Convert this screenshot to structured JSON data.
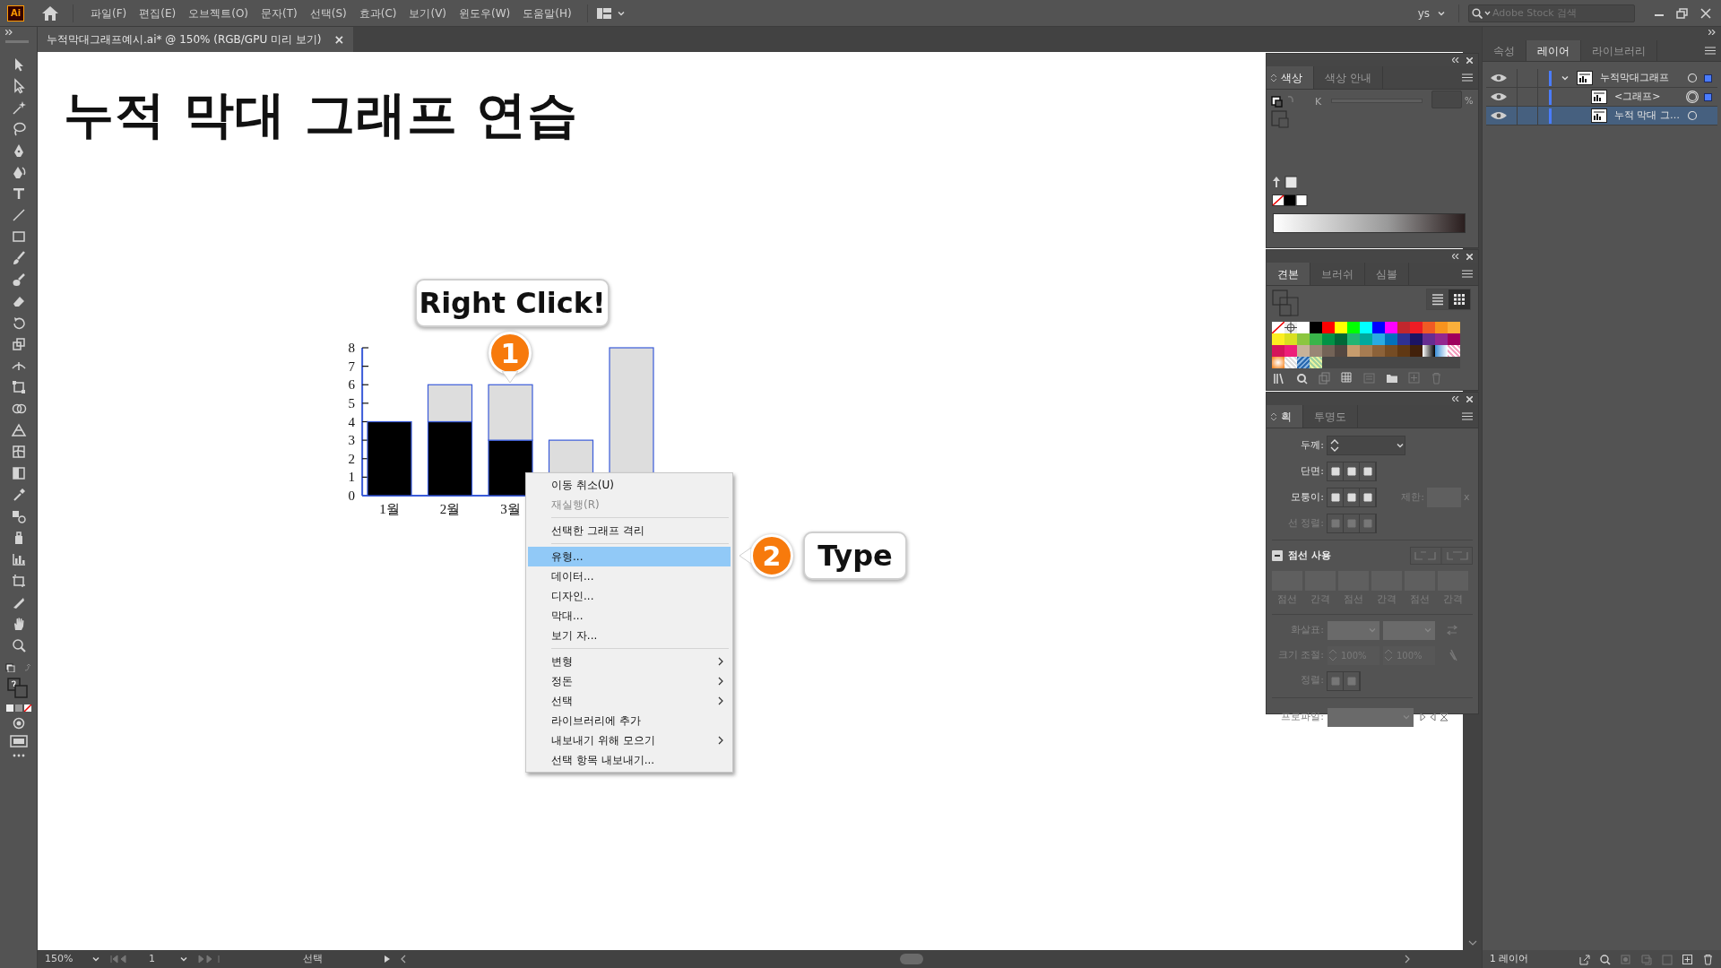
{
  "app": {
    "logo": "Ai",
    "menus": [
      "파일(F)",
      "편집(E)",
      "오브젝트(O)",
      "문자(T)",
      "선택(S)",
      "효과(C)",
      "보기(V)",
      "윈도우(W)",
      "도움말(H)"
    ],
    "user": "ys",
    "search": {
      "placeholder": "Adobe Stock 검색"
    }
  },
  "document_tab": {
    "title": "누적막대그래프예시.ai* @ 150% (RGB/GPU 미리 보기)",
    "close": "×"
  },
  "artboard": {
    "heading": "누적 막대 그래프 연습",
    "callouts": [
      {
        "kind": "bubble",
        "text": "Right Click!"
      },
      {
        "kind": "badge",
        "text": "1"
      },
      {
        "kind": "badge",
        "text": "2"
      },
      {
        "kind": "bubble",
        "text": "Type"
      }
    ],
    "chart_data": {
      "type": "bar",
      "stacked": true,
      "x": [
        1,
        2,
        3,
        4,
        5
      ],
      "xlim": [
        0.55,
        5.4
      ],
      "xticks": [
        {
          "value": 1,
          "label": "1월"
        },
        {
          "value": 2,
          "label": "2월"
        },
        {
          "value": 3,
          "label": "3월"
        }
      ],
      "ylim": [
        0,
        8
      ],
      "yticks": [
        0,
        1,
        2,
        3,
        4,
        5,
        6,
        7,
        8
      ],
      "series": [
        {
          "color": "#000000",
          "values": [
            4,
            4,
            3,
            0,
            0
          ]
        },
        {
          "color": "#dddddd",
          "values": [
            0,
            2,
            3,
            3,
            8
          ]
        }
      ]
    }
  },
  "context_menu": {
    "groups": [
      [
        {
          "label": "이동 취소(U)",
          "disabled": false,
          "selected": false,
          "submenu": false
        },
        {
          "label": "재실행(R)",
          "disabled": true,
          "selected": false,
          "submenu": false
        }
      ],
      [
        {
          "label": "선택한 그래프 격리",
          "disabled": false,
          "selected": false,
          "submenu": false
        }
      ],
      [
        {
          "label": "유형...",
          "disabled": false,
          "selected": true,
          "submenu": false
        },
        {
          "label": "데이터...",
          "disabled": false,
          "selected": false,
          "submenu": false
        },
        {
          "label": "디자인...",
          "disabled": false,
          "selected": false,
          "submenu": false
        },
        {
          "label": "막대...",
          "disabled": false,
          "selected": false,
          "submenu": false
        },
        {
          "label": "보기 자...",
          "disabled": false,
          "selected": false,
          "submenu": false
        }
      ],
      [
        {
          "label": "변형",
          "disabled": false,
          "selected": false,
          "submenu": true
        },
        {
          "label": "정돈",
          "disabled": false,
          "selected": false,
          "submenu": true
        },
        {
          "label": "선택",
          "disabled": false,
          "selected": false,
          "submenu": true
        },
        {
          "label": "라이브러리에 추가",
          "disabled": false,
          "selected": false,
          "submenu": false
        },
        {
          "label": "내보내기 위해 모으기",
          "disabled": false,
          "selected": false,
          "submenu": true
        },
        {
          "label": "선택 항목 내보내기...",
          "disabled": false,
          "selected": false,
          "submenu": false
        }
      ]
    ]
  },
  "color_panel": {
    "tabs": [
      {
        "label": "색상",
        "selected": true
      },
      {
        "label": "색상 안내",
        "selected": false
      }
    ],
    "channel": {
      "label": "K",
      "unit": "%",
      "disabled": true
    }
  },
  "swatches_panel": {
    "tabs": [
      {
        "label": "견본",
        "selected": true
      },
      {
        "label": "브러쉬",
        "selected": false
      },
      {
        "label": "심볼",
        "selected": false
      }
    ],
    "swatches": [
      {
        "color": "#ffffff"
      },
      {
        "color": "#000000"
      },
      {
        "color": "#ff0000"
      },
      {
        "color": "#ffff00"
      },
      {
        "color": "#00ff00"
      },
      {
        "color": "#00ffff"
      },
      {
        "color": "#0000ff"
      },
      {
        "color": "#ff00ff"
      },
      {
        "color": "#c1272d"
      },
      {
        "color": "#ed1c24"
      },
      {
        "color": "#f15a24"
      },
      {
        "color": "#f7931e"
      },
      {
        "color": "#fbb03b"
      },
      {
        "color": "#fcee21"
      },
      {
        "color": "#d9e021"
      },
      {
        "color": "#8cc63f"
      },
      {
        "color": "#39b54a"
      },
      {
        "color": "#009245"
      },
      {
        "color": "#006837"
      },
      {
        "color": "#22b573"
      },
      {
        "color": "#00a99d"
      },
      {
        "color": "#29abe2"
      },
      {
        "color": "#0071bc"
      },
      {
        "color": "#2e3192"
      },
      {
        "color": "#1b1464"
      },
      {
        "color": "#662d91"
      },
      {
        "color": "#93278f"
      },
      {
        "color": "#9e005d"
      },
      {
        "color": "#d4145a"
      },
      {
        "color": "#ed1e79"
      },
      {
        "color": "#c7b299"
      },
      {
        "color": "#998675"
      },
      {
        "color": "#736357"
      },
      {
        "color": "#534741"
      },
      {
        "color": "#c69c6d"
      },
      {
        "color": "#a67c52"
      },
      {
        "color": "#8c6239"
      },
      {
        "color": "#754c24"
      },
      {
        "color": "#603813"
      },
      {
        "color": "#42210b"
      }
    ]
  },
  "stroke_panel": {
    "tabs": [
      {
        "label": "획",
        "selected": true
      },
      {
        "label": "투명도",
        "selected": false
      }
    ],
    "weight": {
      "label": "두께:",
      "disabled": false
    },
    "cap": {
      "label": "단면:",
      "disabled": false
    },
    "corner": {
      "label": "모퉁이:",
      "disabled": false
    },
    "limit": {
      "label": "제한:",
      "unit": "x",
      "disabled": true
    },
    "align": {
      "label": "선 정렬:",
      "disabled": true
    },
    "dashed": {
      "label": "점선 사용",
      "indeterminate": true
    },
    "dash_fields": [
      "점선",
      "간격",
      "점선",
      "간격",
      "점선",
      "간격"
    ],
    "arrowheads": {
      "label": "화살표:",
      "disabled": true
    },
    "scale": {
      "label": "크기 조절:",
      "values": [
        "100%",
        "100%"
      ],
      "disabled": true
    },
    "arrow_align": {
      "label": "정렬:",
      "disabled": true
    },
    "profile": {
      "label": "프로파일:",
      "disabled": true
    }
  },
  "layers_panel": {
    "tabs": [
      {
        "label": "속성",
        "selected": false
      },
      {
        "label": "레이어",
        "selected": true
      },
      {
        "label": "라이브러리",
        "selected": false
      }
    ],
    "layers": [
      {
        "name": "누적막대그래프",
        "expanded": true,
        "selected": false,
        "targeted": false,
        "has_selection": true,
        "children": [
          {
            "name": "<그래프>",
            "selected": false,
            "targeted": true,
            "has_selection": true
          },
          {
            "name": "누적 막대 그…",
            "selected": true,
            "targeted": false,
            "has_selection": false
          }
        ]
      }
    ],
    "footer": "1 레이어"
  },
  "status_bar": {
    "zoom": "150%",
    "page": "1",
    "tool": "선택"
  }
}
